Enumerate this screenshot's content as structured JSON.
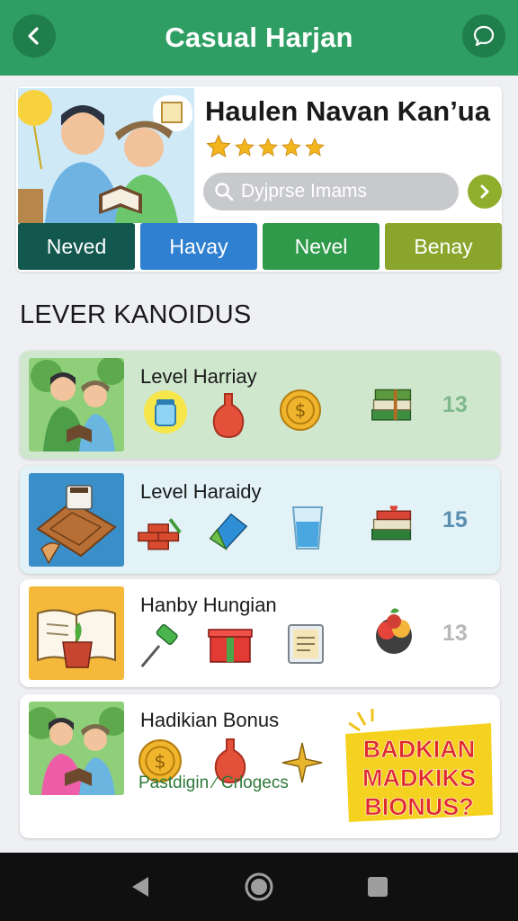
{
  "header": {
    "title": "Casual Harjan",
    "back_icon": "chevron-left-icon",
    "chat_icon": "chat-bubble-icon"
  },
  "profile": {
    "name": "Haulen Navan Kan’ua",
    "rating": 5,
    "search": {
      "placeholder": "Dyjprse Imams"
    },
    "go_icon": "chevron-right-icon",
    "tabs": [
      {
        "label": "Neved",
        "color": "#12584f"
      },
      {
        "label": "Havay",
        "color": "#2f80d0"
      },
      {
        "label": "Nevel",
        "color": "#2f9a49"
      },
      {
        "label": "Benay",
        "color": "#8aa52c"
      }
    ]
  },
  "section": {
    "title": "LEVER KANOIDUS"
  },
  "levels": [
    {
      "title": "Level Harriay",
      "count": "13",
      "bg": "#cfe7cd",
      "count_color": "#7fb88c",
      "items": [
        "jar-icon",
        "vase-icon",
        "coin-icon",
        "books-icon"
      ]
    },
    {
      "title": "Level Haraidy",
      "count": "15",
      "bg": "#e3f2f7",
      "count_color": "#5a8fb0",
      "items": [
        "bricks-icon",
        "prism-icon",
        "glass-icon",
        "gift-books-icon"
      ]
    },
    {
      "title": "Hanby Hungian",
      "count": "13",
      "bg": "#ffffff",
      "count_color": "#b8b8b8",
      "items": [
        "pin-icon",
        "gift-box-icon",
        "note-icon",
        "fruit-bowl-icon"
      ]
    },
    {
      "title": "Hadikian Bonus",
      "bg": "#ffffff",
      "items": [
        "coin-icon",
        "vase-icon",
        "star-icon"
      ],
      "footer": "Pastdigin ∕ Crlogecs",
      "badge": [
        "BADKIAN",
        "MADKIKS",
        "BIONUS?"
      ]
    }
  ],
  "nav": {
    "back_icon": "nav-back-icon",
    "home_icon": "nav-home-icon",
    "recents_icon": "nav-recents-icon"
  },
  "colors": {
    "header": "#2f9e63",
    "background": "#eef0f3"
  }
}
